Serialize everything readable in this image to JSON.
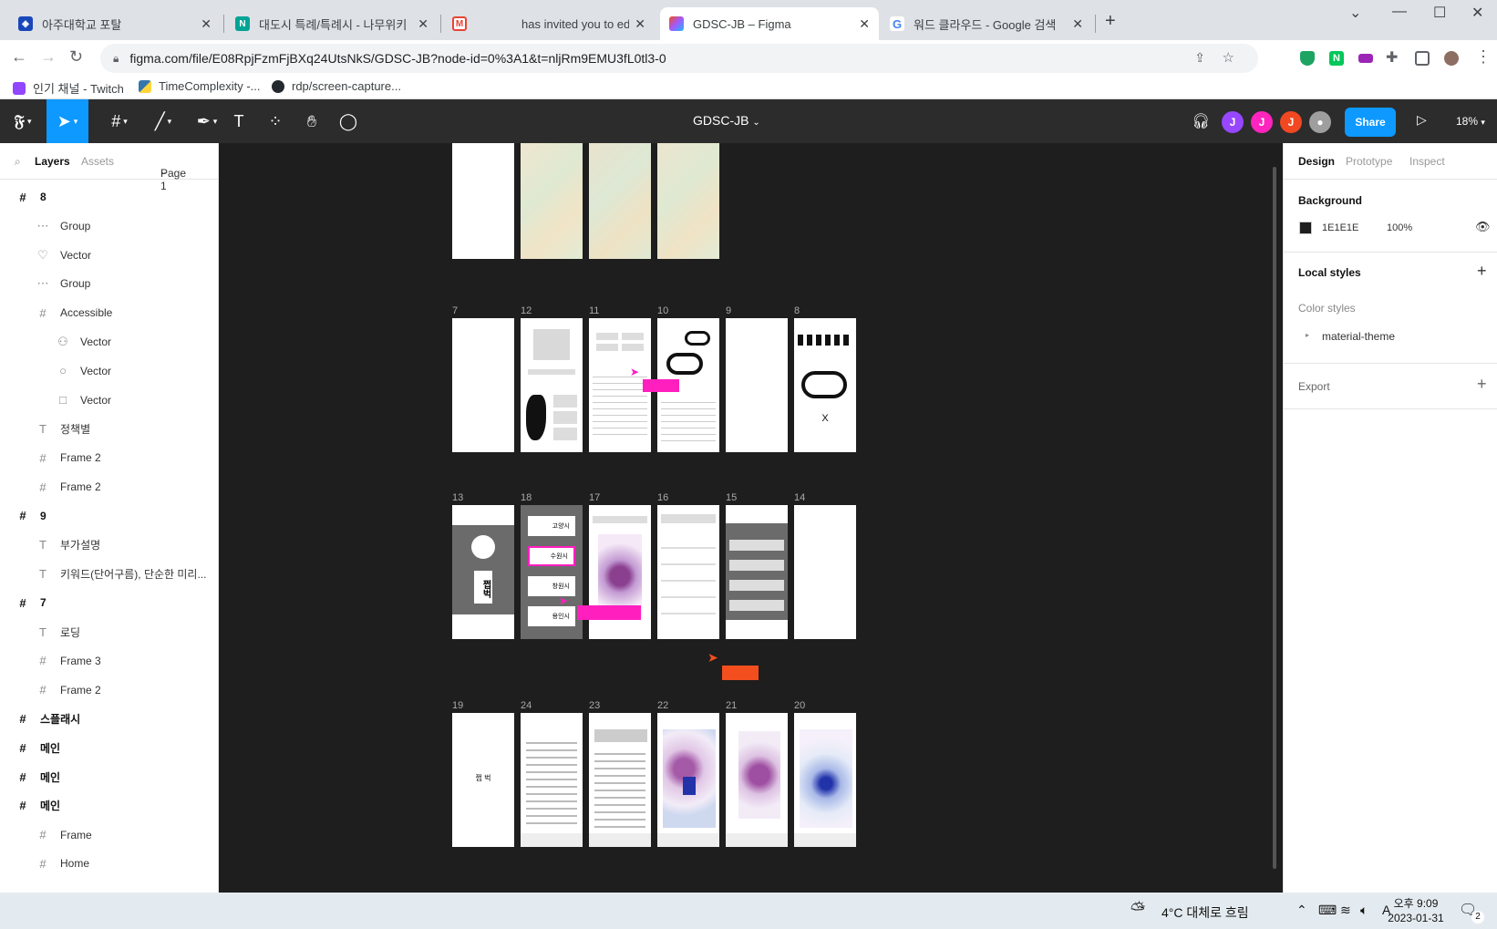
{
  "browser": {
    "tabs": [
      {
        "title": "아주대학교 포탈",
        "active": false
      },
      {
        "title": "대도시 특례/특례시 - 나무위키",
        "active": false
      },
      {
        "title": "has invited you to edit t",
        "active": false
      },
      {
        "title": "GDSC-JB – Figma",
        "active": true
      },
      {
        "title": "워드 클라우드 - Google 검색",
        "active": false
      }
    ],
    "url": "figma.com/file/E08RpjFzmFjBXq24UtsNkS/GDSC-JB?node-id=0%3A1&t=nljRm9EMU3fL0tl3-0",
    "bookmarks": [
      "인기 채널 - Twitch",
      "TimeComplexity -...",
      "rdp/screen-capture..."
    ]
  },
  "figma": {
    "title": "GDSC-JB",
    "avatars": [
      "J",
      "J",
      "J"
    ],
    "share_label": "Share",
    "zoom": "18%"
  },
  "layers_panel": {
    "tab_layers": "Layers",
    "tab_assets": "Assets",
    "page": "Page 1",
    "items": [
      {
        "label": "8",
        "icon": "#",
        "indent": 0,
        "top": true
      },
      {
        "label": "Group",
        "icon": "⋯",
        "indent": 1,
        "top": false
      },
      {
        "label": "Vector",
        "icon": "♡",
        "indent": 1,
        "top": false
      },
      {
        "label": "Group",
        "icon": "⋯",
        "indent": 1,
        "top": false
      },
      {
        "label": "Accessible",
        "icon": "#",
        "indent": 1,
        "top": false
      },
      {
        "label": "Vector",
        "icon": "⚇",
        "indent": 2,
        "top": false
      },
      {
        "label": "Vector",
        "icon": "○",
        "indent": 2,
        "top": false
      },
      {
        "label": "Vector",
        "icon": "□",
        "indent": 2,
        "top": false
      },
      {
        "label": "정책별",
        "icon": "T",
        "indent": 1,
        "top": false
      },
      {
        "label": "Frame 2",
        "icon": "#",
        "indent": 1,
        "top": false
      },
      {
        "label": "Frame 2",
        "icon": "#",
        "indent": 1,
        "top": false
      },
      {
        "label": "9",
        "icon": "#",
        "indent": 0,
        "top": true
      },
      {
        "label": "부가설명",
        "icon": "T",
        "indent": 1,
        "top": false
      },
      {
        "label": "키워드(단어구름), 단순한 미리...",
        "icon": "T",
        "indent": 1,
        "top": false
      },
      {
        "label": "7",
        "icon": "#",
        "indent": 0,
        "top": true
      },
      {
        "label": "로딩",
        "icon": "T",
        "indent": 1,
        "top": false
      },
      {
        "label": "Frame 3",
        "icon": "#",
        "indent": 1,
        "top": false
      },
      {
        "label": "Frame 2",
        "icon": "#",
        "indent": 1,
        "top": false
      },
      {
        "label": "스플래시",
        "icon": "#",
        "indent": 0,
        "top": true
      },
      {
        "label": "메인",
        "icon": "#",
        "indent": 0,
        "top": true
      },
      {
        "label": "메인",
        "icon": "#",
        "indent": 0,
        "top": true
      },
      {
        "label": "메인",
        "icon": "#",
        "indent": 0,
        "top": true
      },
      {
        "label": "Frame",
        "icon": "#",
        "indent": 1,
        "top": false
      },
      {
        "label": "Home",
        "icon": "#",
        "indent": 1,
        "top": false
      }
    ]
  },
  "canvas": {
    "row2_labels": [
      "7",
      "12",
      "11",
      "10",
      "9",
      "8"
    ],
    "row3_labels": [
      "13",
      "18",
      "17",
      "16",
      "15",
      "14"
    ],
    "row4_labels": [
      "19",
      "24",
      "23",
      "22",
      "21",
      "20"
    ],
    "frame8_text": "X",
    "frame13_text": "쩝벅",
    "frame19_text": "쩝 벅",
    "frame18_buttons": [
      "고양시",
      "수원시",
      "창원시",
      "용인시"
    ]
  },
  "design_panel": {
    "tabs": [
      "Design",
      "Prototype",
      "Inspect"
    ],
    "background_label": "Background",
    "background_hex": "1E1E1E",
    "background_opacity": "100%",
    "local_styles_label": "Local styles",
    "color_styles_label": "Color styles",
    "color_style_item": "material-theme",
    "export_label": "Export"
  },
  "taskbar": {
    "weather": "4°C 대체로 흐림",
    "time_ampm": "오후 9:09",
    "date": "2023-01-31",
    "notif_count": "2"
  },
  "colors": {
    "figma_blue": "#0d99ff",
    "magenta": "#ff1fbf",
    "orange": "#f24e1e",
    "avatar_purple": "#9747ff",
    "avatar_pink": "#ff24bd",
    "avatar_orange": "#f24822"
  }
}
